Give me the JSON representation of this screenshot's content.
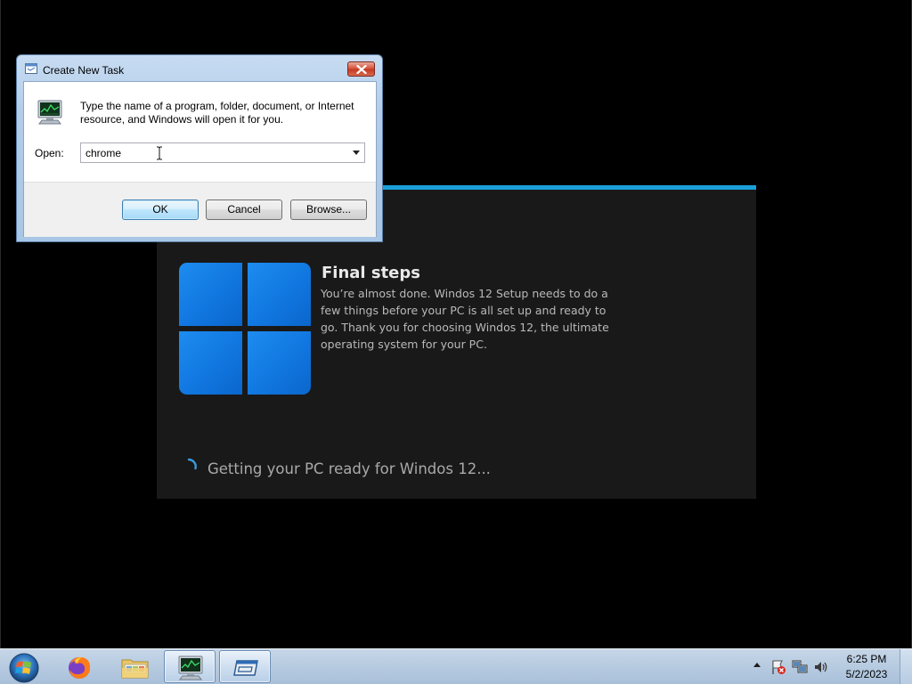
{
  "setup": {
    "title": "Final steps",
    "description": "You’re almost done. Windos 12 Setup needs to do a few things before your PC is all set up and ready to go. Thank you for choosing Windos 12, the ultimate operating system for your PC.",
    "status": "Getting your PC ready for Windos 12...",
    "accent_color": "#1a9fd8",
    "logo_color": "#1177e0",
    "logo_icon": "windows-logo-icon",
    "spinner_icon": "loading-spinner-icon"
  },
  "dialog": {
    "title": "Create New Task",
    "prompt": "Type the name of a program, folder, document, or Internet resource, and Windows will open it for you.",
    "open_label": "Open:",
    "open_value": "chrome",
    "buttons": {
      "ok": "OK",
      "cancel": "Cancel",
      "browse": "Browse..."
    }
  },
  "taskbar": {
    "items": [
      {
        "name": "start-button",
        "icon": "windows-orb-icon"
      },
      {
        "name": "firefox",
        "icon": "firefox-icon"
      },
      {
        "name": "file-explorer",
        "icon": "folder-icon"
      },
      {
        "name": "task-manager",
        "icon": "task-manager-icon",
        "active": true
      },
      {
        "name": "setup",
        "icon": "setup-window-icon",
        "active": true
      }
    ],
    "tray": {
      "icons": [
        "show-hidden-icons-chevron",
        "action-center-flag-icon",
        "network-icon",
        "volume-icon"
      ]
    },
    "clock": {
      "time": "6:25 PM",
      "date": "5/2/2023"
    }
  }
}
